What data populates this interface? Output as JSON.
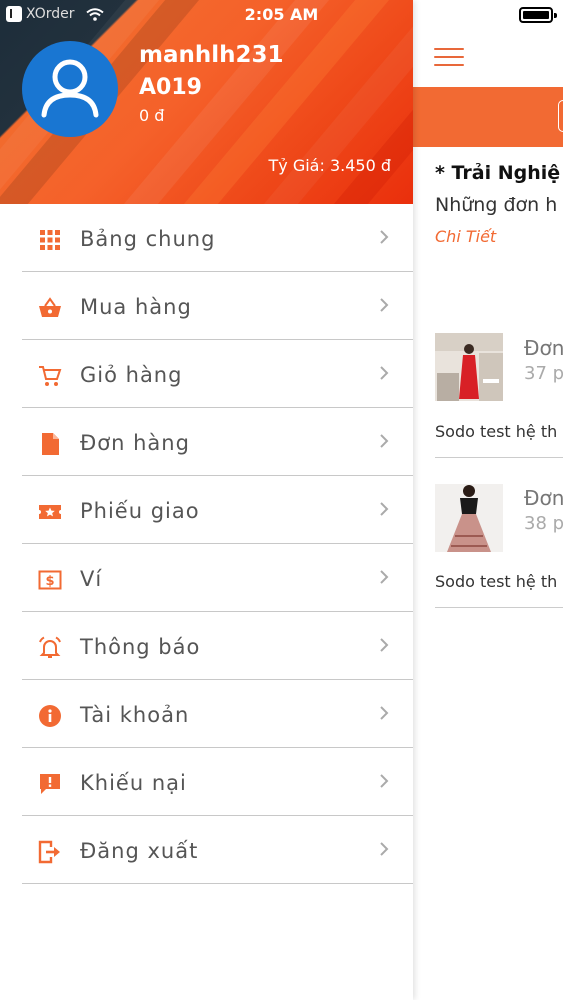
{
  "status_bar": {
    "carrier": "XOrder",
    "time": "2:05 AM"
  },
  "user": {
    "name": "manhlh231",
    "code": "A019",
    "balance": "0 đ",
    "exchange_rate": "Tỷ Giá: 3.450 đ"
  },
  "menu": {
    "items": [
      {
        "label": "Bảng chung",
        "icon": "grid-icon"
      },
      {
        "label": "Mua hàng",
        "icon": "basket-icon"
      },
      {
        "label": "Giỏ hàng",
        "icon": "cart-icon"
      },
      {
        "label": "Đơn hàng",
        "icon": "document-icon"
      },
      {
        "label": "Phiếu giao",
        "icon": "ticket-star-icon"
      },
      {
        "label": "Ví",
        "icon": "dollar-bill-icon"
      },
      {
        "label": "Thông báo",
        "icon": "alarm-bell-icon"
      },
      {
        "label": "Tài khoản",
        "icon": "info-icon"
      },
      {
        "label": "Khiếu nại",
        "icon": "report-icon"
      },
      {
        "label": "Đăng xuất",
        "icon": "logout-icon"
      }
    ]
  },
  "main": {
    "promo": {
      "title": "* Trải Nghiệ",
      "subtitle": "Những đơn h",
      "link": "Chi Tiết"
    },
    "orders": [
      {
        "title": "Đơn",
        "time": "37 p",
        "description": "Sodo test hệ th"
      },
      {
        "title": "Đơn",
        "time": "38 p",
        "description": "Sodo test hệ th"
      }
    ]
  },
  "colors": {
    "accent": "#f26a33",
    "avatar_bg": "#1976d2",
    "header_dark": "#1d2d3a",
    "header_red": "#ea2f0c"
  }
}
